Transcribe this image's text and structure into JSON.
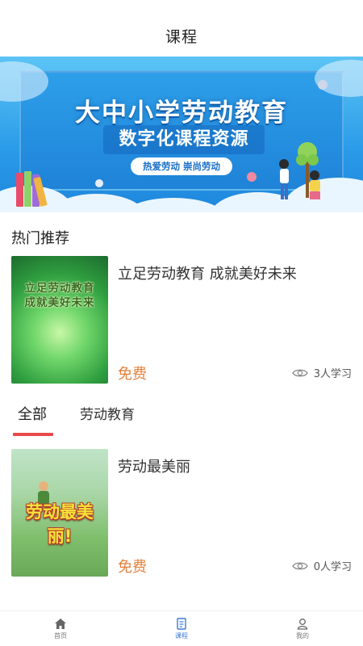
{
  "header": {
    "title": "课程"
  },
  "banner": {
    "title": "大中小学劳动教育",
    "subtitle": "数字化课程资源",
    "pill": "热爱劳动  崇尚劳动"
  },
  "hot": {
    "section_title": "热门推荐",
    "course": {
      "title": "立足劳动教育  成就美好未来",
      "thumb_line1": "立足劳动教育",
      "thumb_line2": "成就美好未来",
      "price": "免费",
      "learners": "3人学习"
    }
  },
  "tabs": [
    {
      "label": "全部",
      "active": true
    },
    {
      "label": "劳动教育",
      "active": false
    }
  ],
  "list": [
    {
      "title": "劳动最美丽",
      "thumb_text": "劳动最美丽!",
      "price": "免费",
      "learners": "0人学习"
    }
  ],
  "bottom_nav": [
    {
      "label": "首页",
      "icon": "home-icon",
      "active": false
    },
    {
      "label": "课程",
      "icon": "course-icon",
      "active": true
    },
    {
      "label": "我的",
      "icon": "profile-icon",
      "active": false
    }
  ],
  "colors": {
    "price": "#e4813c",
    "tab_underline": "#e84a4a",
    "nav_active": "#3a7bd5",
    "banner_blue": "#2a9be8"
  }
}
